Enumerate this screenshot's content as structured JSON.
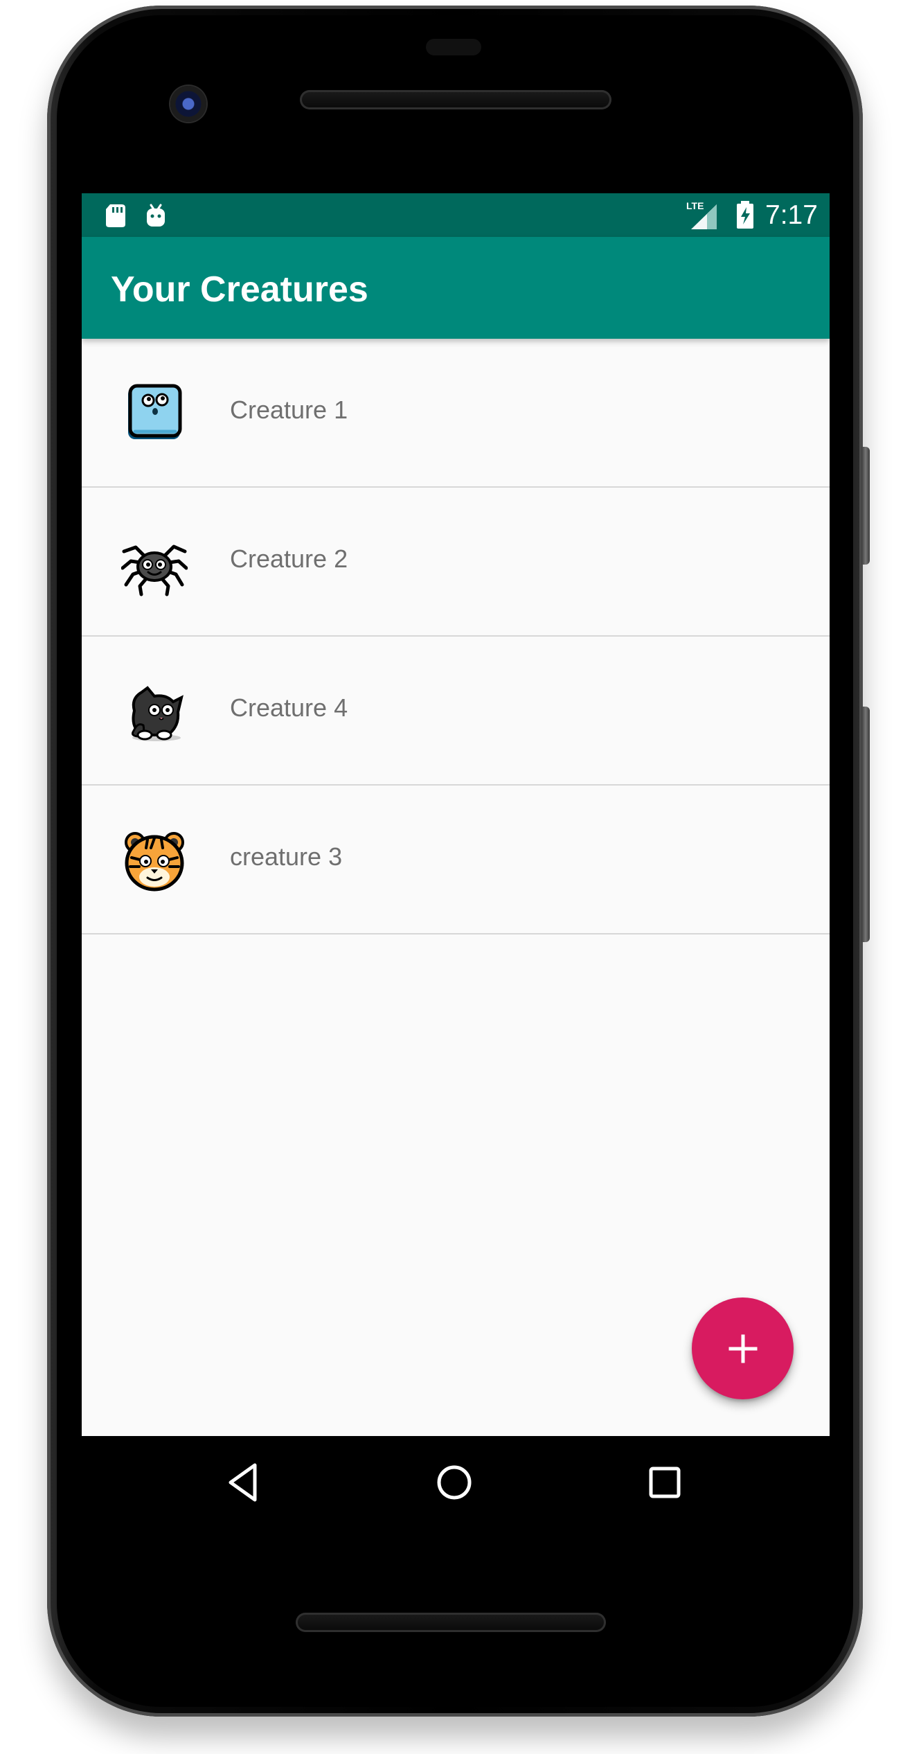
{
  "status_bar": {
    "time": "7:17",
    "network_label": "LTE",
    "icons": [
      "sd-card-icon",
      "android-debug-icon",
      "signal-icon",
      "battery-charging-icon"
    ]
  },
  "toolbar": {
    "title": "Your Creatures"
  },
  "creatures": [
    {
      "name": "Creature 1",
      "avatar": "blue-square-creature-icon"
    },
    {
      "name": "Creature 2",
      "avatar": "spider-creature-icon"
    },
    {
      "name": "Creature 4",
      "avatar": "black-cat-creature-icon"
    },
    {
      "name": "creature 3",
      "avatar": "tiger-creature-icon"
    }
  ],
  "fab": {
    "icon": "plus-icon"
  },
  "navigation": {
    "icons": [
      "back-icon",
      "home-icon",
      "recents-icon"
    ]
  },
  "colors": {
    "status_bar": "#00695c",
    "toolbar": "#00897b",
    "fab": "#d81b60",
    "background": "#fafafa",
    "list_text": "#6f6f6f"
  }
}
